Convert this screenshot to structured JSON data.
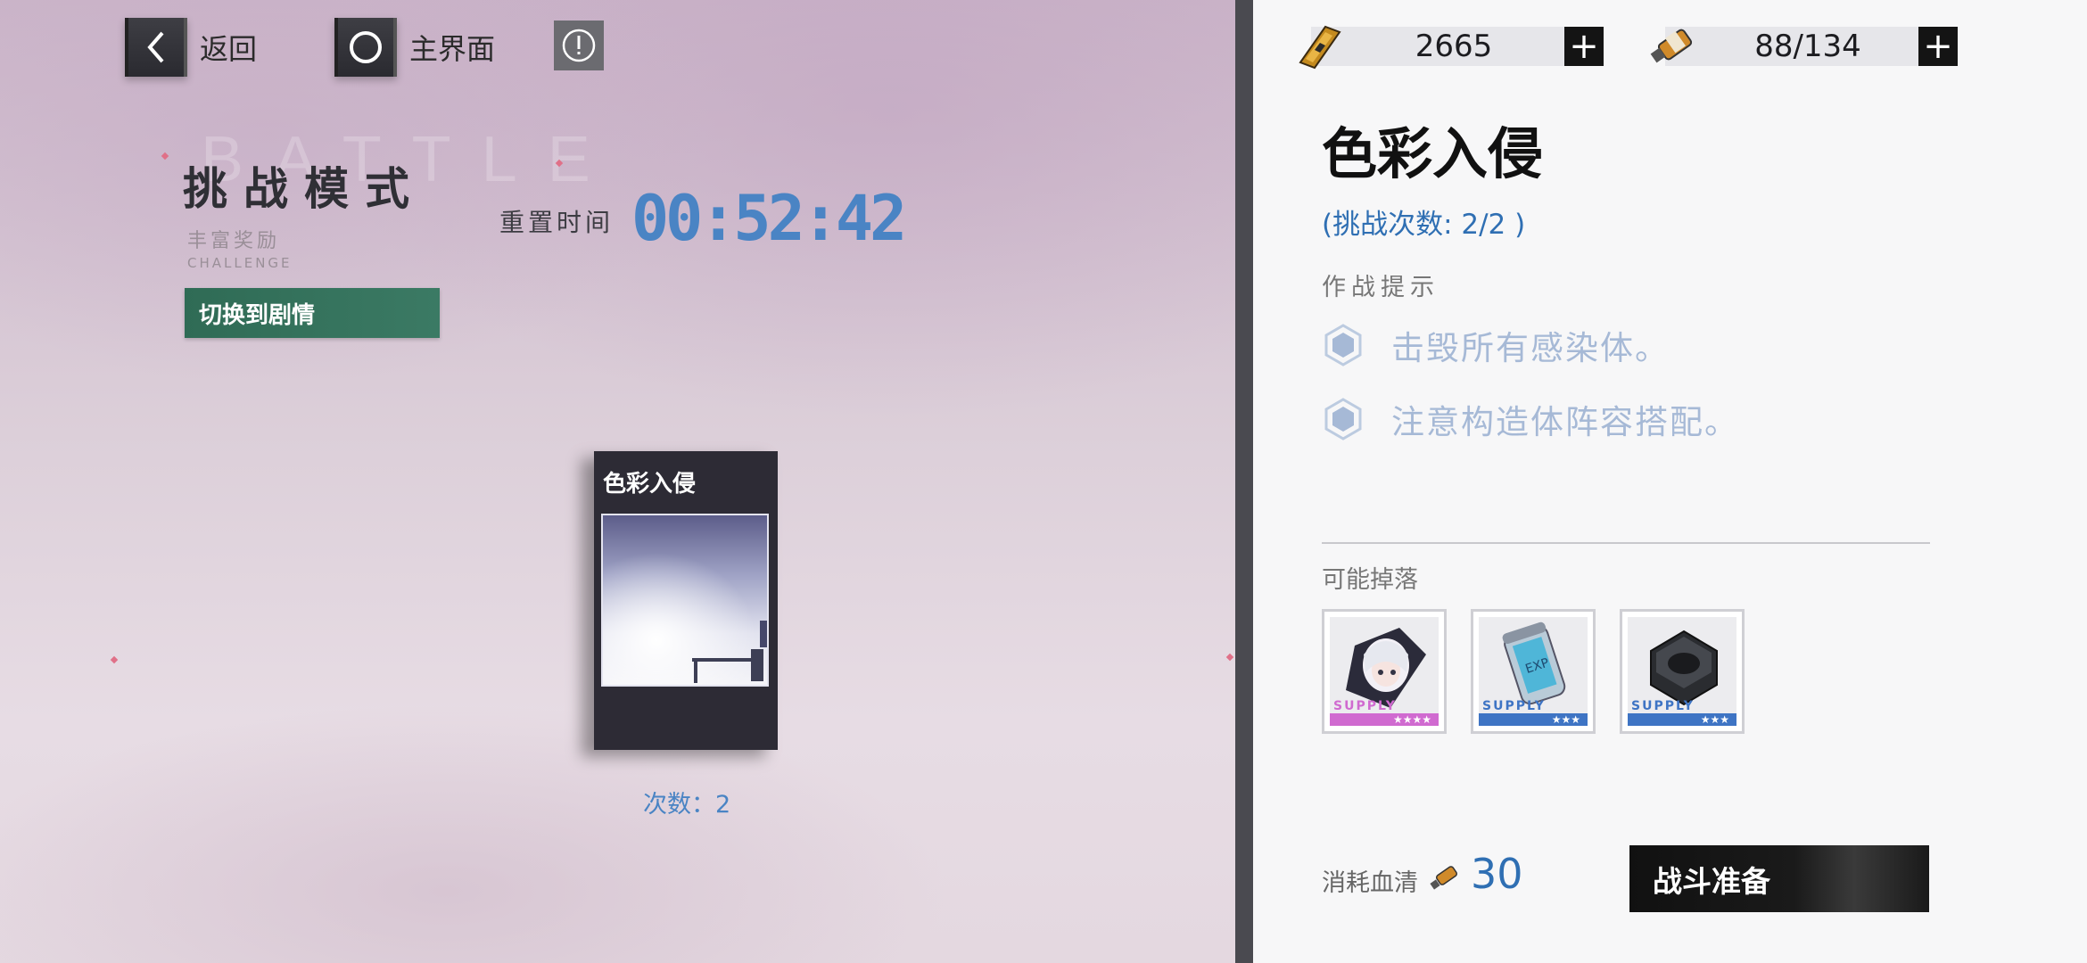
{
  "nav": {
    "back_label": "返回",
    "home_label": "主界面"
  },
  "mode": {
    "watermark": "BATTLE",
    "title": "挑战模式",
    "subtitle": "丰富奖励",
    "subtitle_en": "CHALLENGE",
    "switch_label": "切换到剧情"
  },
  "reset": {
    "label": "重置时间",
    "time": "00:52:42"
  },
  "stage_card": {
    "title": "色彩入侵",
    "count_label": "次数：2"
  },
  "resources": {
    "currency_value": "2665",
    "serum_value": "88/134"
  },
  "detail": {
    "stage_name": "色彩入侵",
    "attempts": "(挑战次数: 2/2 )",
    "hints_heading": "作战提示",
    "hints": [
      "击毁所有感染体。",
      "注意构造体阵容搭配。"
    ],
    "drops_heading": "可能掉落",
    "drops": [
      {
        "icon": "character-card-icon",
        "supply": "SUPPLY",
        "stars": "★★★★",
        "color": "#d06ad0"
      },
      {
        "icon": "exp-canister-icon",
        "supply": "SUPPLY",
        "stars": "★★★",
        "color": "#3e74c4"
      },
      {
        "icon": "hex-nut-icon",
        "supply": "SUPPLY",
        "stars": "★★★",
        "color": "#3e74c4"
      }
    ],
    "cost_label": "消耗血清",
    "cost_value": "30",
    "battle_label": "战斗准备"
  },
  "colors": {
    "accent_blue": "#4a84c4",
    "switch_green": "#2f6b55"
  }
}
